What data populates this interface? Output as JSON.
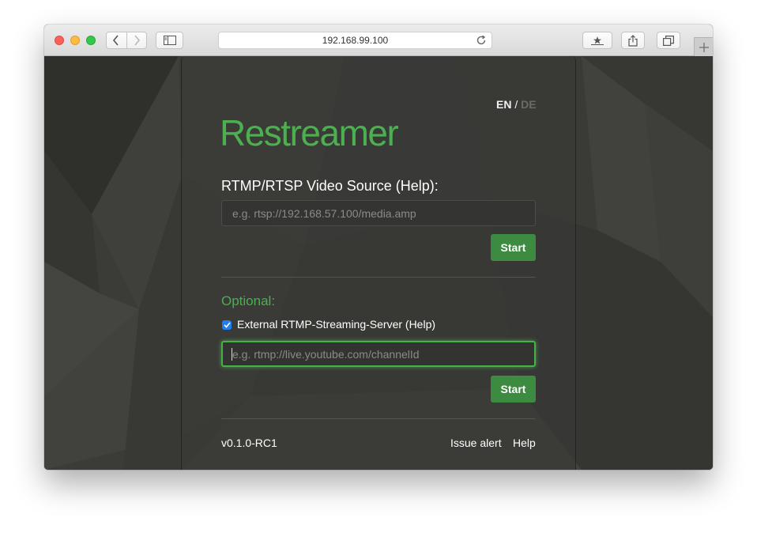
{
  "browser": {
    "url": "192.168.99.100",
    "colors": {
      "close": "#fc605b",
      "minimize": "#fdbc40",
      "maximize": "#34c84a"
    },
    "icons": [
      "back-icon",
      "forward-icon",
      "sidebar-icon",
      "reload-icon",
      "bookmark-icon",
      "share-icon",
      "tabs-icon",
      "plus-icon"
    ]
  },
  "app": {
    "logo": "Restreamer",
    "lang": {
      "en": "EN",
      "separator": "/",
      "de": "DE"
    },
    "source": {
      "label": "RTMP/RTSP Video Source (Help):",
      "placeholder": "e.g. rtsp://192.168.57.100/media.amp",
      "value": "",
      "start_label": "Start"
    },
    "optional": {
      "heading": "Optional:",
      "checkbox_label": "External RTMP-Streaming-Server (Help)",
      "checked": true,
      "placeholder": "e.g. rtmp://live.youtube.com/channelId",
      "value": "",
      "start_label": "Start"
    },
    "footer": {
      "version": "v0.1.0-RC1",
      "issue_label": "Issue alert",
      "help_label": "Help"
    },
    "colors": {
      "accent": "#4caf50",
      "button": "#3d8b40",
      "checkbox": "#1f7ef5"
    }
  }
}
